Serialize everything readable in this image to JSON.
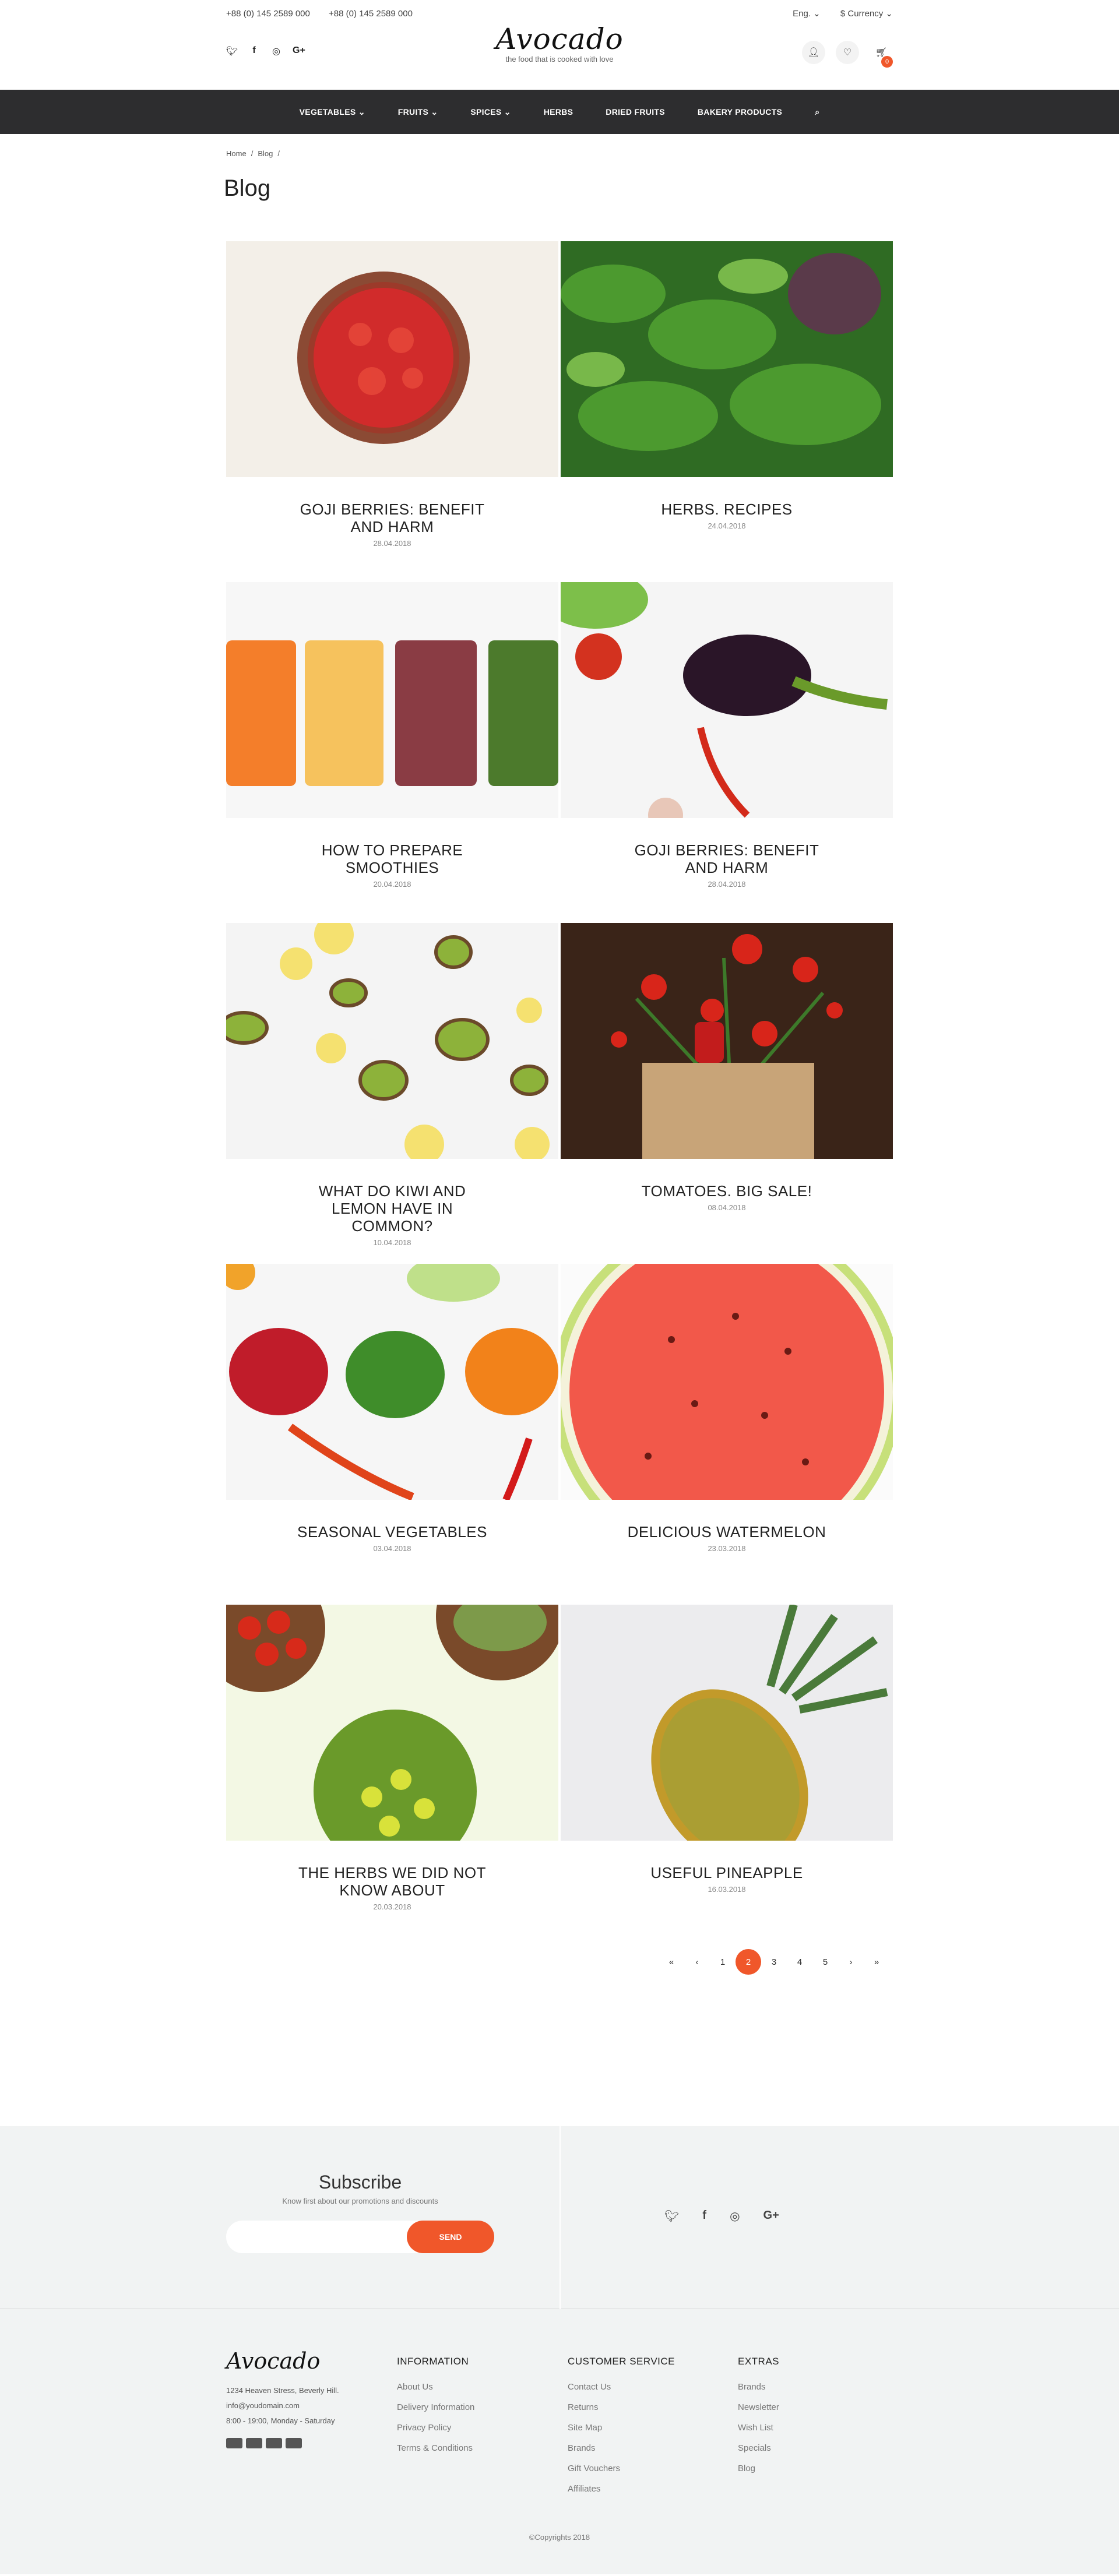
{
  "topbar": {
    "phone1": "+88 (0) 145 2589 000",
    "phone2": "+88 (0) 145 2589 000",
    "lang": "Eng.",
    "currency": "$ Currency"
  },
  "brand": {
    "name": "Avocado",
    "tagline": "the food that is cooked with love"
  },
  "header": {
    "cart_count": "0"
  },
  "nav": [
    "VEGETABLES",
    "FRUITS",
    "SPICES",
    "HERBS",
    "DRIED FRUITS",
    "BAKERY PRODUCTS"
  ],
  "breadcrumb": [
    "Home",
    "/",
    "Blog",
    "/"
  ],
  "page_title": "Blog",
  "posts": [
    {
      "title": "GOJI BERRIES: BENEFIT AND HARM",
      "date": "28.04.2018"
    },
    {
      "title": "HERBS. RECIPES",
      "date": "24.04.2018"
    },
    {
      "title": "HOW TO PREPARE SMOOTHIES",
      "date": "20.04.2018"
    },
    {
      "title": "GOJI BERRIES: BENEFIT AND HARM",
      "date": "28.04.2018"
    },
    {
      "title": "WHAT DO KIWI AND LEMON HAVE IN COMMON?",
      "date": "10.04.2018"
    },
    {
      "title": "TOMATOES. BIG SALE!",
      "date": "08.04.2018"
    },
    {
      "title": "SEASONAL VEGETABLES",
      "date": "03.04.2018"
    },
    {
      "title": "DELICIOUS WATERMELON",
      "date": "23.03.2018"
    },
    {
      "title": "THE HERBS WE DID NOT KNOW ABOUT",
      "date": "20.03.2018"
    },
    {
      "title": "USEFUL PINEAPPLE",
      "date": "16.03.2018"
    }
  ],
  "pagination": {
    "first": "«",
    "prev": "‹",
    "pages": [
      "1",
      "2",
      "3",
      "4",
      "5"
    ],
    "next": "›",
    "last": "»",
    "active": "2"
  },
  "subscribe": {
    "title": "Subscribe",
    "subtitle": "Know first about our promotions and discounts",
    "button": "SEND",
    "placeholder": ""
  },
  "footer": {
    "address": "1234 Heaven Stress, Beverly Hill.",
    "email": "info@youdomain.com",
    "hours": "8:00 - 19:00, Monday - Saturday",
    "information": {
      "title": "INFORMATION",
      "items": [
        "About Us",
        "Delivery Information",
        "Privacy Policy",
        "Terms & Conditions"
      ]
    },
    "customer_service": {
      "title": "CUSTOMER SERVICE",
      "items": [
        "Contact Us",
        "Returns",
        "Site Map",
        "Brands",
        "Gift Vouchers",
        "Affiliates"
      ]
    },
    "extras": {
      "title": "EXTRAS",
      "items": [
        "Brands",
        "Newsletter",
        "Wish List",
        "Specials",
        "Blog"
      ]
    },
    "copyright": "©Copyrights 2018"
  },
  "colors": {
    "accent": "#f0572a",
    "nav_bg": "#2d2d2f",
    "footer_bg": "#f1f3f3"
  }
}
